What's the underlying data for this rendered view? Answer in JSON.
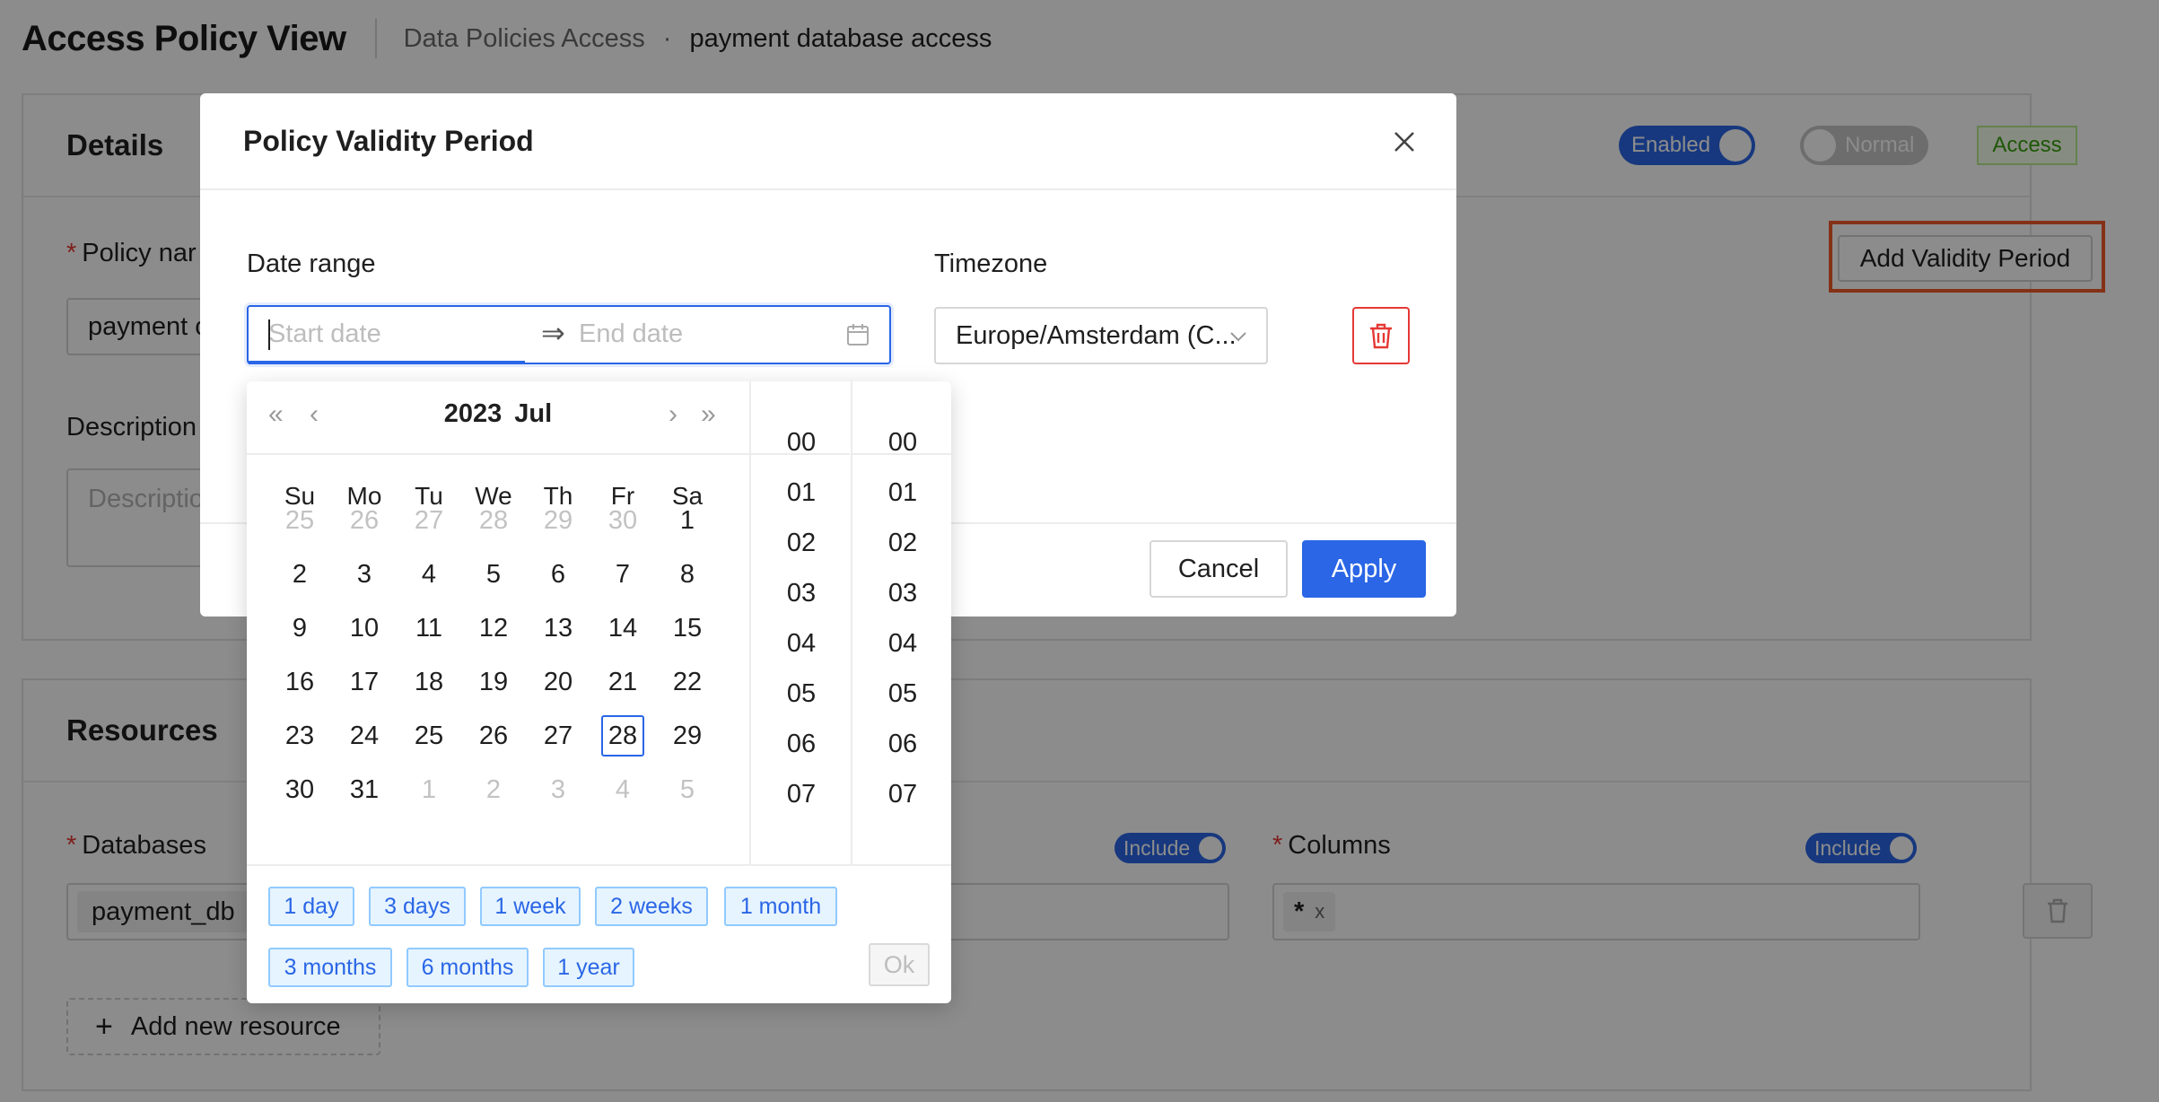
{
  "header": {
    "title": "Access Policy View",
    "breadcrumb": [
      "Data Policies Access",
      "payment database access"
    ],
    "separator": "·"
  },
  "details": {
    "title": "Details",
    "toggle_enabled": "Enabled",
    "toggle_normal": "Normal",
    "tag_access": "Access",
    "add_validity_button": "Add Validity Period",
    "policy_name_label": "Policy nar",
    "policy_name_value": "payment c",
    "description_label": "Description",
    "description_placeholder": "Descriptio"
  },
  "resources": {
    "title": "Resources",
    "databases_label": "Databases",
    "databases_chip": "payment_db",
    "include_label": "Include",
    "columns_label": "Columns",
    "columns_chip": "*",
    "columns_chip_close": "x",
    "add_resource": "Add new resource"
  },
  "modal": {
    "title": "Policy Validity Period",
    "date_range_label": "Date range",
    "start_placeholder": "Start date",
    "end_placeholder": "End date",
    "timezone_label": "Timezone",
    "timezone_value": "Europe/Amsterdam (C...",
    "cancel": "Cancel",
    "apply": "Apply"
  },
  "picker": {
    "year": "2023",
    "month": "Jul",
    "weekdays": [
      "Su",
      "Mo",
      "Tu",
      "We",
      "Th",
      "Fr",
      "Sa"
    ],
    "weeks": [
      [
        "25",
        "26",
        "27",
        "28",
        "29",
        "30",
        "1"
      ],
      [
        "2",
        "3",
        "4",
        "5",
        "6",
        "7",
        "8"
      ],
      [
        "9",
        "10",
        "11",
        "12",
        "13",
        "14",
        "15"
      ],
      [
        "16",
        "17",
        "18",
        "19",
        "20",
        "21",
        "22"
      ],
      [
        "23",
        "24",
        "25",
        "26",
        "27",
        "28",
        "29"
      ],
      [
        "30",
        "31",
        "1",
        "2",
        "3",
        "4",
        "5"
      ]
    ],
    "today": "28",
    "hours": [
      "00",
      "01",
      "02",
      "03",
      "04",
      "05",
      "06",
      "07"
    ],
    "minutes": [
      "00",
      "01",
      "02",
      "03",
      "04",
      "05",
      "06",
      "07"
    ],
    "presets": [
      "1 day",
      "3 days",
      "1 week",
      "2 weeks",
      "1 month",
      "3 months",
      "6 months",
      "1 year"
    ],
    "ok": "Ok"
  },
  "colors": {
    "primary": "#2a66e6",
    "danger": "#e53935",
    "highlight": "#f05a28",
    "success": "#389e0d"
  }
}
